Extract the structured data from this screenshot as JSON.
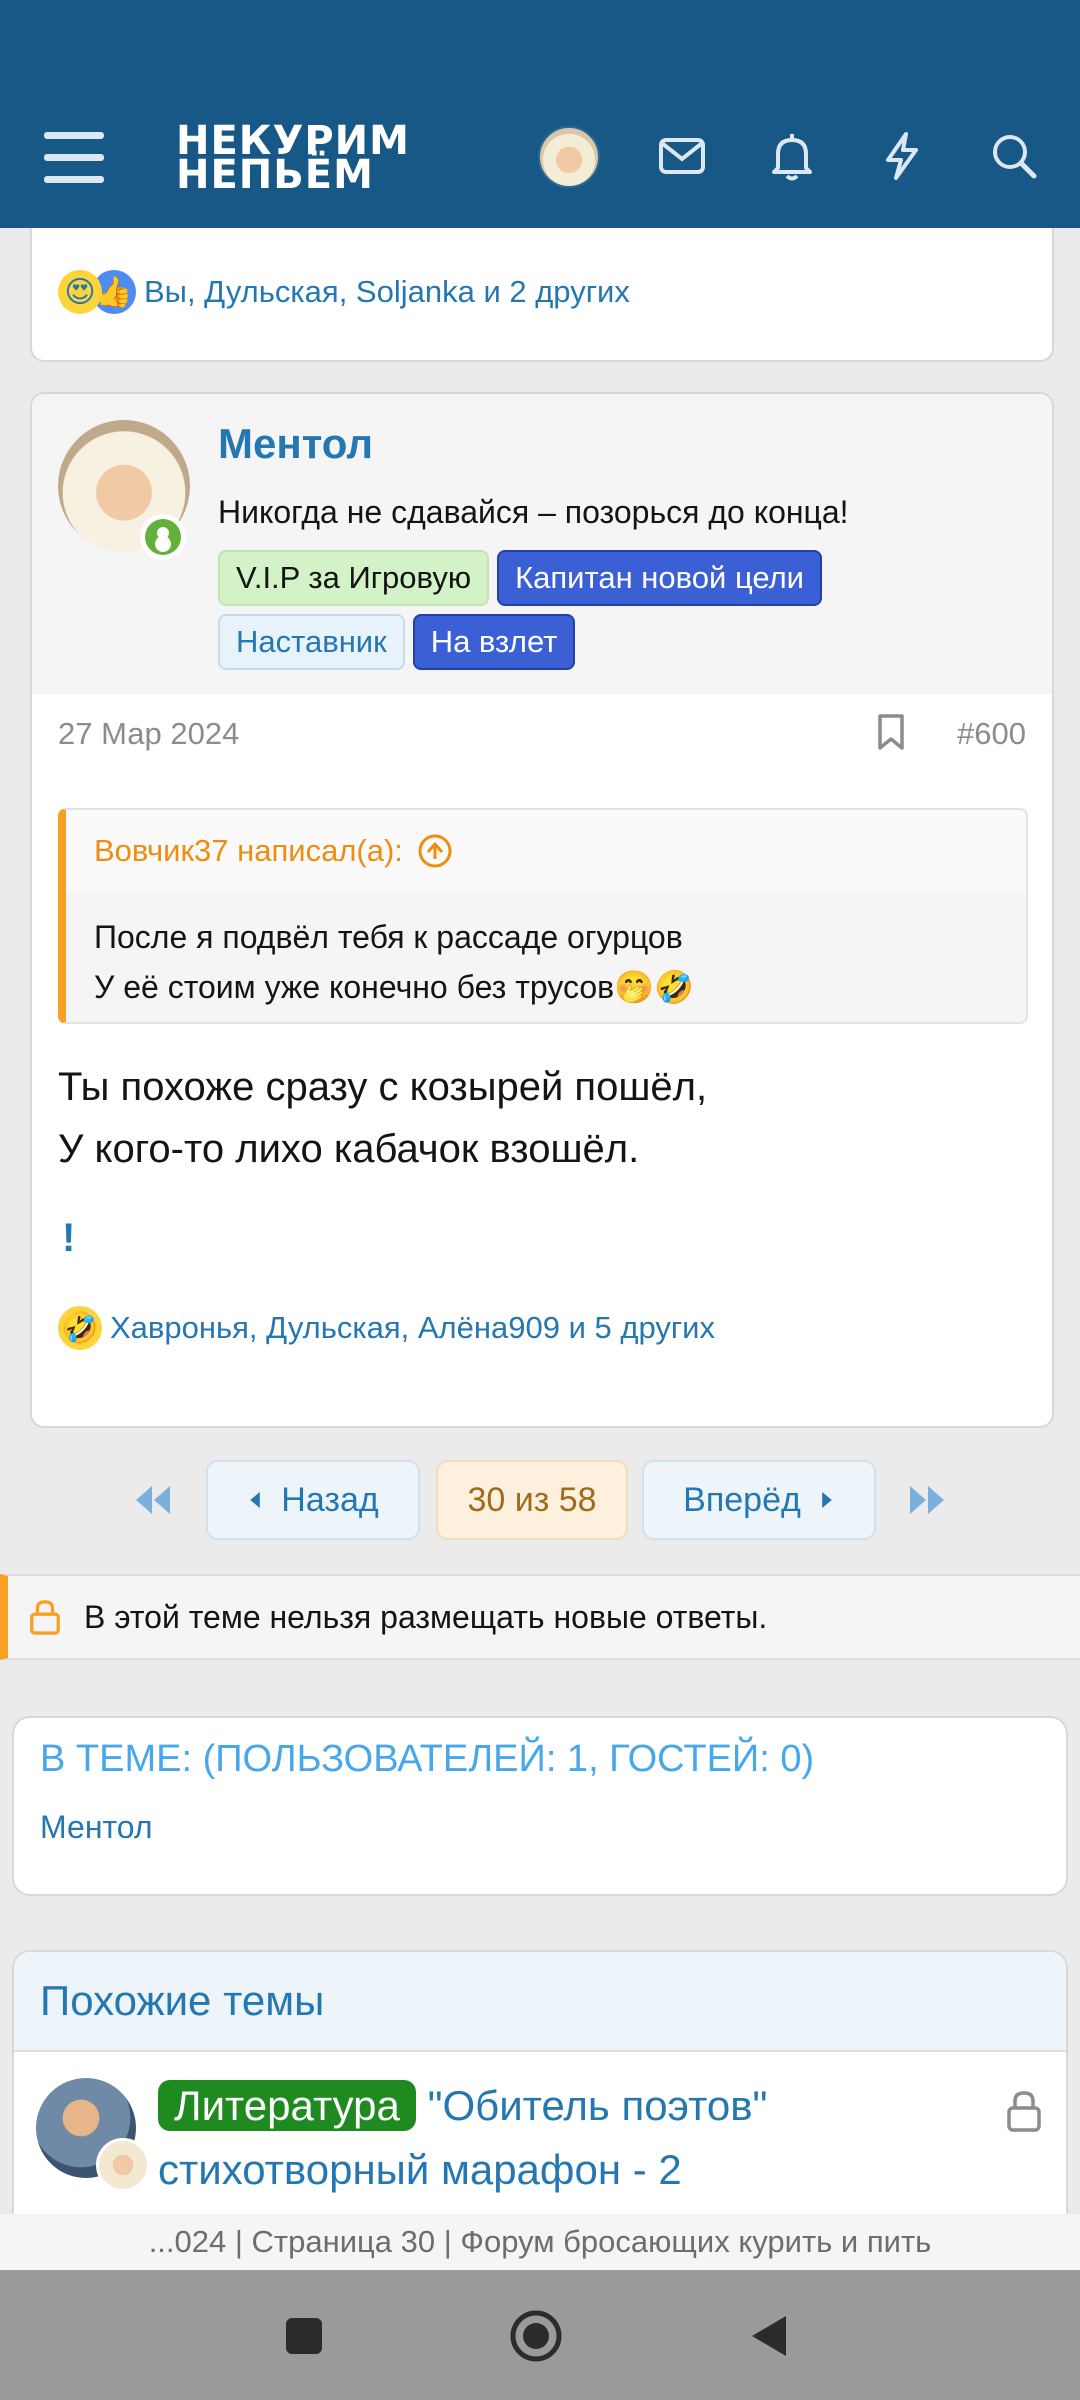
{
  "header": {
    "logo_line1": "НЕКУРИМ",
    "logo_line2": "НЕПЬЁМ",
    "icons": [
      "menu-icon",
      "avatar",
      "mail-icon",
      "bell-icon",
      "bolt-icon",
      "search-icon"
    ]
  },
  "prev_post": {
    "reactions_text": "Вы, Дульская, Soljanka и 2 других",
    "reaction_emojis": [
      "😍",
      "👍"
    ]
  },
  "post": {
    "username": "Ментол",
    "user_title": "Никогда не сдавайся – позорься до конца!",
    "banners": [
      {
        "label": "V.I.P за Игровую",
        "style": "green"
      },
      {
        "label": "Капитан новой цели",
        "style": "blue"
      },
      {
        "label": "Наставник",
        "style": "light"
      },
      {
        "label": "На взлет",
        "style": "blue"
      }
    ],
    "date": "27 Мар 2024",
    "number": "#600",
    "quote": {
      "author": "Вовчик37 написал(а):",
      "line1": "После я подвёл тебя к рассаде огурцов",
      "line2": "У её стоим уже конечно без трусов🤭🤣"
    },
    "message_line1": "Ты похоже сразу с козырей пошёл,",
    "message_line2": "У кого-то лихо кабачок взошёл.",
    "exclamation": "!",
    "reactions_text": "Хавронья, Дульская, Алёна909 и 5 других",
    "reaction_emoji": "🤣"
  },
  "pagination": {
    "back": "Назад",
    "current": "30 из 58",
    "forward": "Вперёд"
  },
  "notice": "В этой теме нельзя размещать новые ответы.",
  "in_thread": {
    "title": "В ТЕМЕ: (ПОЛЬЗОВАТЕЛЕЙ: 1, ГОСТЕЙ: 0)",
    "users": [
      "Ментол"
    ]
  },
  "similar": {
    "title": "Похожие темы",
    "threads": [
      {
        "prefix": "Литература",
        "title": "\"Обитель поэтов\" стихотворный марафон - 2"
      }
    ]
  },
  "browser_title": "...024 | Страница 30 | Форум бросающих курить и пить",
  "colors": {
    "header": "#185886",
    "link": "#2577b1",
    "accent": "#f7a024",
    "prefix_green": "#1f8a1f"
  }
}
